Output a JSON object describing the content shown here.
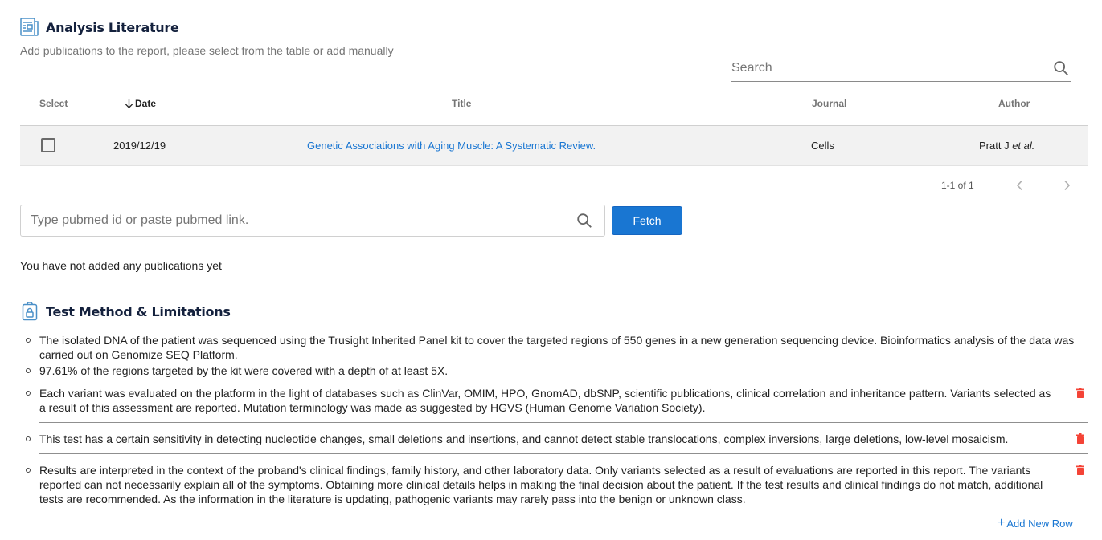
{
  "literature": {
    "title": "Analysis Literature",
    "subtitle": "Add publications to the report, please select from the table or add manually",
    "search": {
      "placeholder": "Search",
      "value": ""
    },
    "table": {
      "columns": {
        "select": "Select",
        "date": "Date",
        "title": "Title",
        "journal": "Journal",
        "author": "Author"
      },
      "sort": {
        "column": "date",
        "direction": "descending"
      },
      "rows": [
        {
          "selected": false,
          "date": "2019/12/19",
          "title": "Genetic Associations with Aging Muscle: A Systematic Review.",
          "journal": "Cells",
          "author_name": "Pratt J",
          "author_suffix": "et al."
        }
      ]
    },
    "pagination": {
      "range": "1-1 of 1"
    },
    "pubmed": {
      "placeholder": "Type pubmed id or paste pubmed link.",
      "value": "",
      "fetch_label": "Fetch"
    },
    "empty_message": "You have not added any publications yet"
  },
  "test_method": {
    "title": "Test Method & Limitations",
    "items": [
      {
        "text": "The isolated DNA of the patient was sequenced using the Trusight Inherited Panel kit to cover the targeted regions of 550 genes in a new generation sequencing device. Bioinformatics analysis of the data was carried out on Genomize SEQ Platform.",
        "deletable": false
      },
      {
        "text": "97.61% of the regions targeted by the kit were covered with a depth of at least 5X.",
        "deletable": false
      },
      {
        "text": "Each variant was evaluated on the platform in the light of databases such as ClinVar, OMIM, HPO, GnomAD, dbSNP, scientific publications, clinical correlation and inheritance pattern. Variants selected as a result of this assessment are reported. Mutation terminology was made as suggested by HGVS (Human Genome Variation Society).",
        "deletable": true
      },
      {
        "text": "This test has a certain sensitivity in detecting nucleotide changes, small deletions and insertions, and cannot detect stable translocations, complex inversions, large deletions, low-level mosaicism.",
        "deletable": true
      },
      {
        "text": "Results are interpreted in the context of the proband's clinical findings, family history, and other laboratory data. Only variants selected as a result of evaluations are reported in this report. The variants reported can not necessarily explain all of the symptoms. Obtaining more clinical details helps in making the final decision about the patient. If the test results and clinical findings do not match, additional tests are recommended. As the information in the literature is updating, pathogenic variants may rarely pass into the benign or unknown class.",
        "deletable": true
      }
    ],
    "add_row_label": "Add New Row"
  },
  "icons": {
    "literature": "newspaper-icon",
    "test_method": "clipboard-lock-icon",
    "search": "search-icon",
    "sort": "arrow-down-icon",
    "prev": "chevron-left-icon",
    "next": "chevron-right-icon",
    "delete": "trash-icon",
    "add": "plus-icon"
  },
  "colors": {
    "accent": "#1976d2",
    "heading": "#14213d",
    "delete": "#f44336",
    "row_bg": "#f2f2f2",
    "icon_blue": "#4a90c8"
  }
}
